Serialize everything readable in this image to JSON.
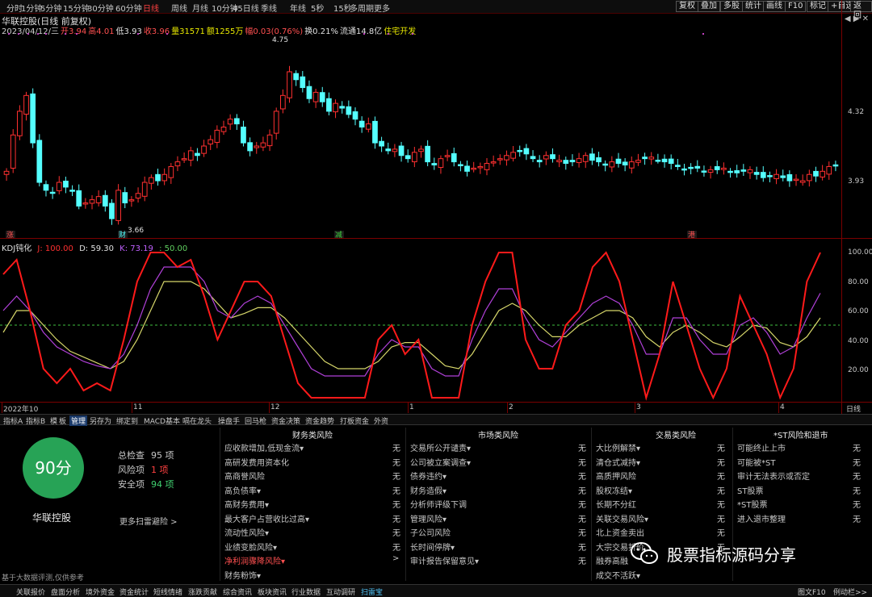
{
  "toolbar": {
    "periods": [
      "分时",
      "1分钟",
      "5分钟",
      "15分钟",
      "30分钟",
      "60分钟",
      "日线",
      "周线",
      "月线",
      "10分钟",
      "45日线",
      "季线",
      "年线",
      "5秒",
      "15秒",
      "多周期",
      "更多"
    ],
    "active_period": "日线",
    "right_buttons": [
      "复权",
      "叠加",
      "多股",
      "统计",
      "画线",
      "F10",
      "标记",
      "+自选",
      "返回"
    ]
  },
  "header": {
    "title": "华联控股(日线 前复权)",
    "info": [
      {
        "text": "2023/04/12/三",
        "color": "#d0d0d0"
      },
      {
        "text": "开3.94",
        "color": "#ff5050"
      },
      {
        "text": "高4.01",
        "color": "#ff5050"
      },
      {
        "text": "低3.93",
        "color": "#e0e0e0"
      },
      {
        "text": "收3.96",
        "color": "#ff5050"
      },
      {
        "text": "量31571",
        "color": "#e8e800"
      },
      {
        "text": "额1255万",
        "color": "#e8e800"
      },
      {
        "text": "幅0.03(0.76%)",
        "color": "#ff5050"
      },
      {
        "text": "换0.21%",
        "color": "#e0e0e0"
      },
      {
        "text": "流通14.8亿",
        "color": "#e0e0e0"
      },
      {
        "text": "住宅开发",
        "color": "#e8e800"
      }
    ],
    "window_icons": "◀ ▶ ✕"
  },
  "price_chart": {
    "y_labels": [
      "4.32",
      "3.93"
    ],
    "high_marker": "4.75",
    "low_marker": "3.66",
    "event_labels": [
      "涨",
      "财",
      "减",
      "港"
    ],
    "colors": {
      "up": "#ff3030",
      "down": "#54ffff"
    }
  },
  "indicator": {
    "title": "KDJ钝化",
    "j_label": "J: 100.00",
    "d_label": "D: 59.30",
    "k_label": "K: 73.19",
    "ref_label": ": 50.00",
    "y_labels": [
      "100.00",
      "80.00",
      "60.00",
      "40.00",
      "20.00"
    ],
    "colors": {
      "j": "#ff1a1a",
      "d": "#d6d66a",
      "k": "#b040d8",
      "ref": "#40c040"
    }
  },
  "chart_data": {
    "type": "line",
    "title": "KDJ钝化",
    "ylim": [
      0,
      100
    ],
    "series": [
      {
        "name": "J",
        "values": [
          85,
          95,
          60,
          20,
          10,
          20,
          5,
          10,
          5,
          40,
          80,
          100,
          100,
          90,
          95,
          70,
          40,
          60,
          80,
          80,
          70,
          40,
          10,
          0,
          0,
          0,
          0,
          0,
          40,
          50,
          30,
          40,
          0,
          0,
          0,
          50,
          80,
          100,
          100,
          40,
          20,
          20,
          50,
          60,
          90,
          100,
          80,
          40,
          0,
          30,
          80,
          50,
          20,
          0,
          20,
          70,
          50,
          30,
          0,
          20,
          80,
          100
        ]
      },
      {
        "name": "K",
        "values": [
          60,
          70,
          60,
          45,
          35,
          30,
          25,
          22,
          20,
          30,
          50,
          75,
          90,
          90,
          90,
          80,
          60,
          55,
          65,
          70,
          65,
          50,
          35,
          20,
          15,
          15,
          15,
          15,
          30,
          40,
          35,
          35,
          20,
          15,
          15,
          40,
          60,
          75,
          75,
          55,
          40,
          35,
          45,
          55,
          65,
          70,
          65,
          50,
          30,
          30,
          55,
          55,
          40,
          30,
          30,
          50,
          55,
          45,
          30,
          35,
          55,
          72
        ]
      },
      {
        "name": "D",
        "values": [
          45,
          60,
          60,
          50,
          40,
          32,
          28,
          24,
          20,
          25,
          40,
          60,
          80,
          80,
          80,
          75,
          65,
          55,
          58,
          62,
          62,
          55,
          45,
          35,
          25,
          20,
          20,
          20,
          25,
          35,
          38,
          38,
          30,
          22,
          20,
          30,
          45,
          60,
          65,
          60,
          50,
          42,
          42,
          50,
          55,
          60,
          60,
          55,
          42,
          35,
          45,
          50,
          45,
          38,
          35,
          42,
          50,
          48,
          38,
          35,
          42,
          55
        ]
      },
      {
        "name": "50",
        "values": [
          50
        ]
      }
    ],
    "xlabels": [
      "2022年10",
      "11",
      "12",
      "1",
      "2",
      "3",
      "4"
    ]
  },
  "date_axis": {
    "labels": [
      "2022年10",
      "11",
      "12",
      "1",
      "2",
      "3",
      "4"
    ],
    "right": "日线"
  },
  "tabs": [
    "指标A",
    "指标B",
    "模",
    "板",
    "管理",
    "另存为",
    "绑定到",
    "MACD基本",
    "嗝在龙头",
    "操盘手",
    "回马枪",
    "资金决策",
    "资金趋势",
    "打板资金",
    "外资"
  ],
  "risk_panel": {
    "score": "90分",
    "company": "华联控股",
    "stats": [
      {
        "label": "总检查",
        "value": "95 项",
        "color": "#c8c8c8"
      },
      {
        "label": "风险项",
        "value": "1 项",
        "color": "#ff4040"
      },
      {
        "label": "安全项",
        "value": "94 项",
        "color": "#40d070"
      }
    ],
    "more": "更多扫雷避险 >",
    "columns": [
      {
        "title": "财务类风险",
        "items": [
          {
            "t": "应收款增加,低现金流▾",
            "v": "无"
          },
          {
            "t": "高研发费用资本化",
            "v": "无"
          },
          {
            "t": "高商誉风险",
            "v": "无"
          },
          {
            "t": "高负债率▾",
            "v": "无"
          },
          {
            "t": "高财务费用▾",
            "v": "无"
          },
          {
            "t": "最大客户占营收比过高▾",
            "v": "无"
          },
          {
            "t": "流动性风险▾",
            "v": "无"
          },
          {
            "t": "业绩变脸风险▾",
            "v": "无"
          },
          {
            "t": "净利润骤降风险▾",
            "v": ">"
          },
          {
            "t": "财务粉饰▾",
            "v": ""
          }
        ]
      },
      {
        "title": "市场类风险",
        "items": [
          {
            "t": "交易所公开谴责▾",
            "v": "无"
          },
          {
            "t": "公司被立案调查▾",
            "v": "无"
          },
          {
            "t": "债券违约▾",
            "v": "无"
          },
          {
            "t": "财务造假▾",
            "v": "无"
          },
          {
            "t": "分析师评级下调",
            "v": "无"
          },
          {
            "t": "管理风险▾",
            "v": "无"
          },
          {
            "t": "子公司风险",
            "v": "无"
          },
          {
            "t": "长时间停牌▾",
            "v": "无"
          },
          {
            "t": "审计报告保留意见▾",
            "v": "无"
          }
        ]
      },
      {
        "title": "交易类风险",
        "items": [
          {
            "t": "大比例解禁▾",
            "v": "无"
          },
          {
            "t": "清仓式减持▾",
            "v": "无"
          },
          {
            "t": "高质押风险",
            "v": "无"
          },
          {
            "t": "股权冻结▾",
            "v": "无"
          },
          {
            "t": "长期不分红",
            "v": "无"
          },
          {
            "t": "关联交易风险▾",
            "v": "无"
          },
          {
            "t": "北上资金卖出",
            "v": "无"
          },
          {
            "t": "大宗交易折价",
            "v": "无"
          },
          {
            "t": "融券高融",
            "v": ""
          },
          {
            "t": "成交不活跃▾",
            "v": ""
          }
        ]
      },
      {
        "title": "*ST风险和退市",
        "items": [
          {
            "t": "可能终止上市",
            "v": "无"
          },
          {
            "t": "可能被*ST",
            "v": "无"
          },
          {
            "t": "审计无法表示或否定",
            "v": "无"
          },
          {
            "t": "ST股票",
            "v": "无"
          },
          {
            "t": "*ST股票",
            "v": "无"
          },
          {
            "t": "进入退市整理",
            "v": "无"
          }
        ]
      }
    ],
    "footnote": "基于大数据评测,仅供参考"
  },
  "watermark": "股票指标源码分享",
  "statusbar": {
    "items": [
      "关联报价",
      "盘面分析",
      "境外资金",
      "资金统计",
      "短线情绪",
      "涨跌贡献",
      "综合资讯",
      "板块资讯",
      "行业数据",
      "互动调研",
      "扫雷宝"
    ],
    "selected": "扫雷宝",
    "right": [
      "图文F10",
      "例动栏>>"
    ]
  }
}
